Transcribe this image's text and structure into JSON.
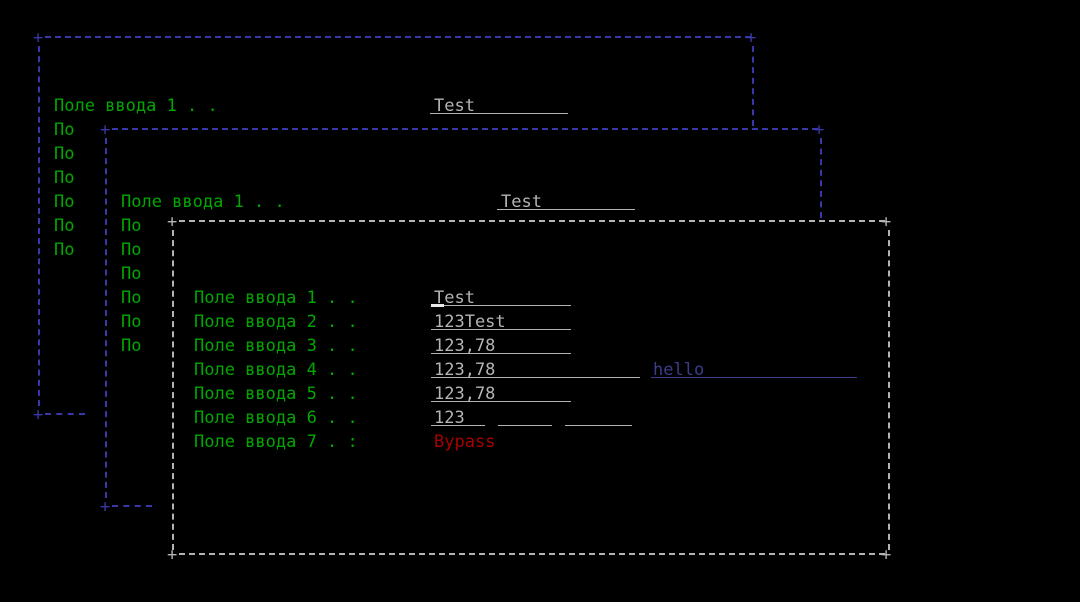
{
  "terminal": {
    "background": "#000000",
    "char_width": 13.4,
    "line_height": 24,
    "colors": {
      "label_green": "#00a800",
      "border_blue": "#3838a8",
      "border_white": "#b4b4b4",
      "value_white": "#b4b4b4",
      "value_red": "#a80000",
      "value_navy": "#3c3c8c"
    }
  },
  "dialogs": [
    {
      "id": "dialog-1",
      "border_color": "#3838a8",
      "left_col": 0,
      "right_col": 54,
      "top_row": 0,
      "bottom_row": 16,
      "rows": [
        {
          "label": "Поле ввода 1 . .",
          "value": "Test"
        },
        {
          "label": "По"
        },
        {
          "label": "По"
        },
        {
          "label": "По"
        },
        {
          "label": "По"
        },
        {
          "label": "По"
        },
        {
          "label": "По"
        }
      ]
    },
    {
      "id": "dialog-2",
      "border_color": "#3838a8",
      "left_col": 5,
      "right_col": 59,
      "top_row": 4,
      "bottom_row": 20,
      "rows": [
        {
          "label": "Поле ввода 1 . .",
          "value": "Test"
        },
        {
          "label": "По"
        },
        {
          "label": "По"
        },
        {
          "label": "По"
        },
        {
          "label": "По"
        },
        {
          "label": "По"
        }
      ]
    },
    {
      "id": "dialog-3",
      "border_color": "#b4b4b4",
      "left_col": 10,
      "right_col": 64,
      "top_row": 8,
      "bottom_row": 22
    }
  ],
  "form": {
    "fields": [
      {
        "label": "Поле ввода 1 . .",
        "value": "Test",
        "value_color": "#b4b4b4",
        "underline": true,
        "underline_chars": 10,
        "caret": true
      },
      {
        "label": "Поле ввода 2 . .",
        "value": "123Test",
        "value_color": "#b4b4b4",
        "underline": true,
        "underline_chars": 10
      },
      {
        "label": "Поле ввода 3 . .",
        "value": "123,78",
        "value_color": "#b4b4b4",
        "underline": true,
        "underline_chars": 10
      },
      {
        "label": "Поле ввода 4 . .",
        "value": "123,78",
        "value_color": "#b4b4b4",
        "underline": true,
        "underline_chars": 15,
        "extra": {
          "value": "hello",
          "value_color": "#3c3c8c",
          "underline": true,
          "underline_chars": 15
        }
      },
      {
        "label": "Поле ввода 5 . .",
        "value": "123,78",
        "value_color": "#b4b4b4",
        "underline": true,
        "underline_chars": 10
      },
      {
        "label": "Поле ввода 6 . .",
        "value": "123",
        "value_color": "#b4b4b4",
        "underline": true,
        "underline_chars": 4,
        "segments": [
          {
            "chars": 4
          },
          {
            "chars": 5
          }
        ]
      },
      {
        "label": "Поле ввода 7 . :",
        "value": "Bypass",
        "value_color": "#a80000",
        "underline": false
      }
    ]
  },
  "gutter": {
    "short_label": "По",
    "dialog1_repeats": 7,
    "dialog2_repeats": 6
  }
}
